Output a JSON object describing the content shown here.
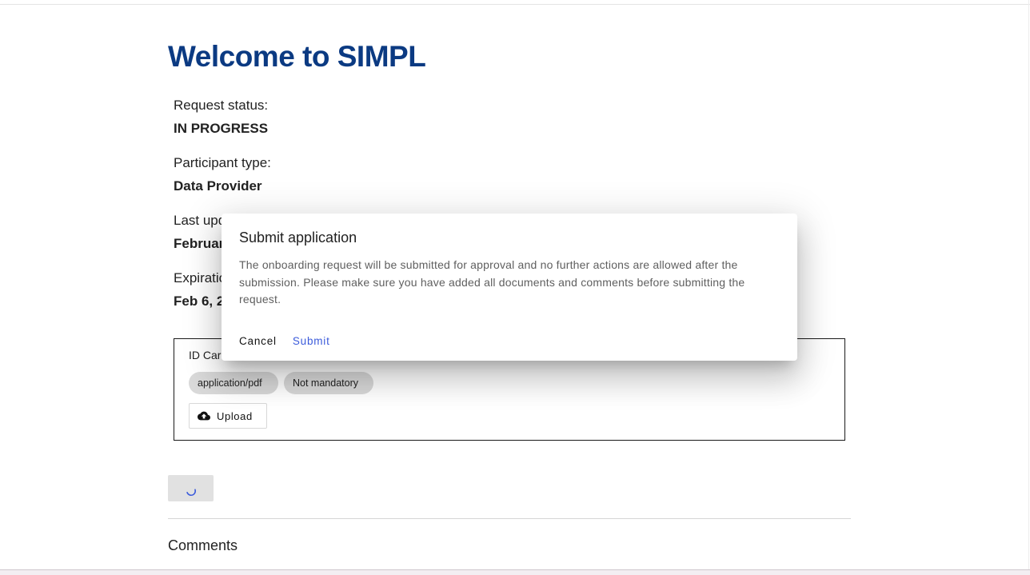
{
  "page": {
    "title": "Welcome to SIMPL"
  },
  "fields": {
    "status_label": "Request status:",
    "status_value": "IN PROGRESS",
    "participant_label": "Participant type:",
    "participant_value": "Data Provider",
    "last_updated_label": "Last upd",
    "last_updated_value": "Februar",
    "expiration_label": "Expiratio",
    "expiration_value": "Feb 6, 2"
  },
  "document": {
    "name": "ID Car",
    "mime_type": "application/pdf",
    "mandatory": "Not mandatory",
    "upload_label": "Upload",
    "upload_icon": "cloud-upload-icon"
  },
  "comments": {
    "title": "Comments"
  },
  "dialog": {
    "title": "Submit application",
    "body": "The onboarding request will be submitted for approval and no further actions are allowed after the submission. Please make sure you have added all documents and comments before submitting the request.",
    "cancel_label": "Cancel",
    "submit_label": "Submit"
  },
  "colors": {
    "title": "#0b3a82",
    "submit": "#3b5bdb",
    "chip_bg": "#d9d9d9"
  }
}
